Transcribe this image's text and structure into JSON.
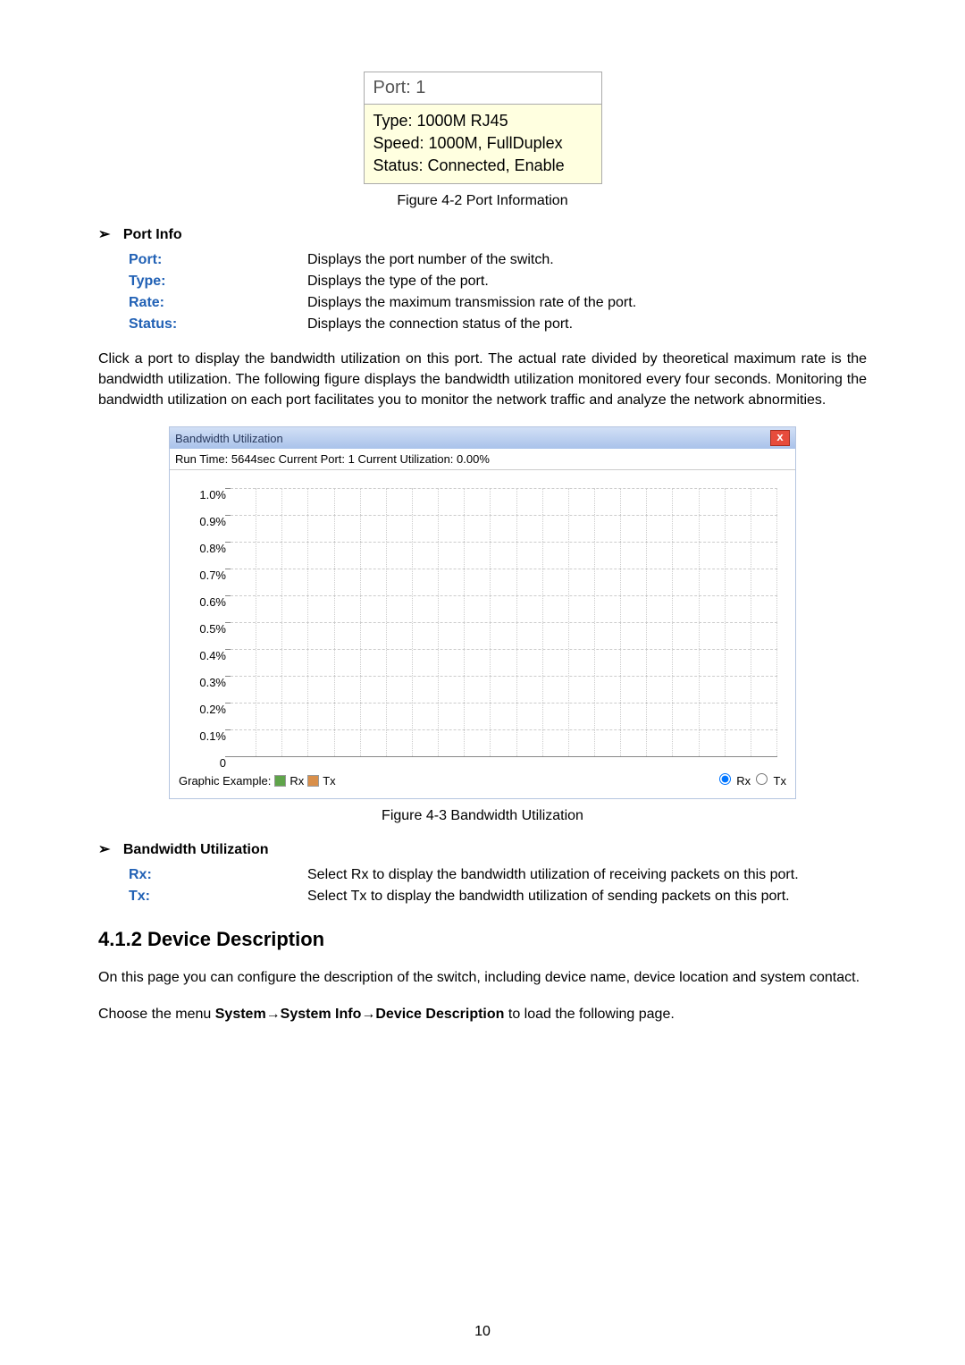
{
  "port_box": {
    "header": "Port: 1",
    "line1": "Type: 1000M RJ45",
    "line2": "Speed: 1000M, FullDuplex",
    "line3": "Status: Connected, Enable"
  },
  "caption1": "Figure 4-2 Port Information",
  "section1_title": "Port Info",
  "defs1": [
    {
      "label": "Port:",
      "desc": "Displays the port number of the switch."
    },
    {
      "label": "Type:",
      "desc": "Displays the type of the port."
    },
    {
      "label": "Rate:",
      "desc": "Displays the maximum transmission rate of the port."
    },
    {
      "label": "Status:",
      "desc": "Displays the connection status of the port."
    }
  ],
  "para1": "Click a port to display the bandwidth utilization on this port. The actual rate divided by theoretical maximum rate is the bandwidth utilization. The following figure displays the bandwidth utilization monitored every four seconds. Monitoring the bandwidth utilization on each port facilitates you to monitor the network traffic and analyze the network abnormities.",
  "bw": {
    "title": "Bandwidth Utilization",
    "close": "x",
    "info": "Run Time: 5644sec Current Port: 1 Current Utilization: 0.00%",
    "legend_prefix": "Graphic Example:",
    "rx": "Rx",
    "tx": "Tx"
  },
  "chart_data": {
    "type": "line",
    "title": "Bandwidth Utilization",
    "ylabel": "",
    "xlabel": "",
    "ylim": [
      0,
      1.0
    ],
    "y_ticks": [
      "1.0%",
      "0.9%",
      "0.8%",
      "0.7%",
      "0.6%",
      "0.5%",
      "0.4%",
      "0.3%",
      "0.2%",
      "0.1%",
      "0"
    ],
    "x_columns": 21,
    "series": [
      {
        "name": "Rx",
        "values": []
      },
      {
        "name": "Tx",
        "values": []
      }
    ]
  },
  "caption2": "Figure 4-3 Bandwidth Utilization",
  "section2_title": "Bandwidth Utilization",
  "defs2": [
    {
      "label": "Rx:",
      "desc": "Select Rx to display the bandwidth utilization of receiving packets on this port."
    },
    {
      "label": "Tx:",
      "desc": "Select Tx to display the bandwidth utilization of sending packets on this port."
    }
  ],
  "h3": "4.1.2 Device Description",
  "para2": "On this page you can configure the description of the switch, including device name, device location and system contact.",
  "para3_pre": "Choose the menu ",
  "para3_bold": "System→System Info→Device Description",
  "para3_post": " to load the following page.",
  "page_number": "10"
}
